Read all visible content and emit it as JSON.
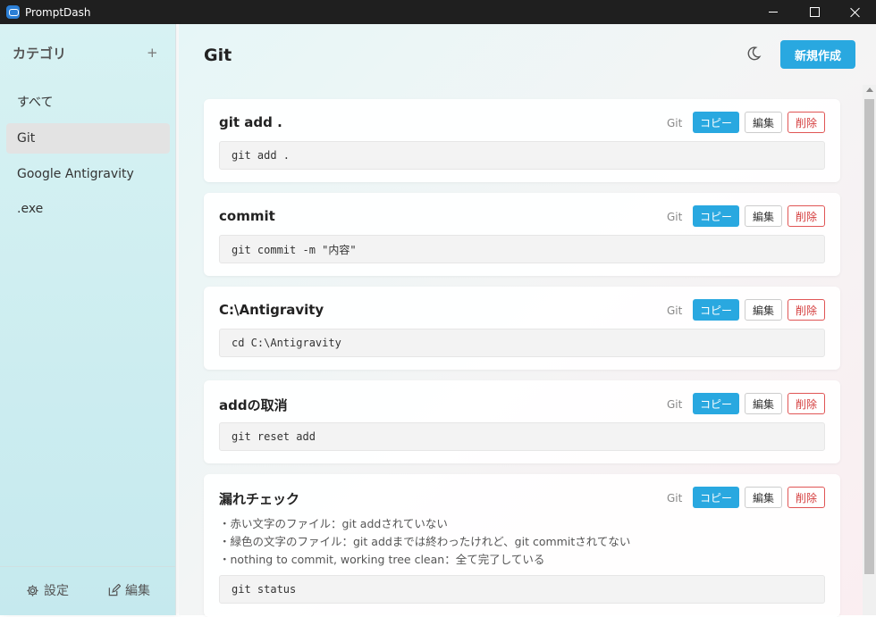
{
  "window": {
    "title": "PromptDash"
  },
  "sidebar": {
    "header": "カテゴリ",
    "add": "+",
    "items": [
      {
        "label": "すべて"
      },
      {
        "label": "Git"
      },
      {
        "label": "Google Antigravity"
      },
      {
        "label": ".exe"
      }
    ],
    "footer": {
      "settings": "設定",
      "edit": "編集"
    }
  },
  "main": {
    "title": "Git",
    "new_button": "新規作成",
    "cards": [
      {
        "title": "git add .",
        "category": "Git",
        "copy": "コピー",
        "edit": "編集",
        "delete": "削除",
        "code": "git add ."
      },
      {
        "title": "commit",
        "category": "Git",
        "copy": "コピー",
        "edit": "編集",
        "delete": "削除",
        "code": "git commit -m \"内容\""
      },
      {
        "title": "C:\\Antigravity",
        "category": "Git",
        "copy": "コピー",
        "edit": "編集",
        "delete": "削除",
        "code": "cd C:\\Antigravity"
      },
      {
        "title": "addの取消",
        "category": "Git",
        "copy": "コピー",
        "edit": "編集",
        "delete": "削除",
        "code": "git reset  add"
      },
      {
        "title": "漏れチェック",
        "category": "Git",
        "copy": "コピー",
        "edit": "編集",
        "delete": "削除",
        "description": [
          "・赤い文字のファイル：git addされていない",
          "・緑色の文字のファイル：git addまでは終わったけれど、git commitされてない",
          "・nothing to commit, working tree clean：全て完了している"
        ],
        "code": "git status"
      }
    ]
  },
  "colors": {
    "accent": "#29a8e0",
    "danger": "#d43d3d",
    "titlebar": "#1f1f1f"
  }
}
